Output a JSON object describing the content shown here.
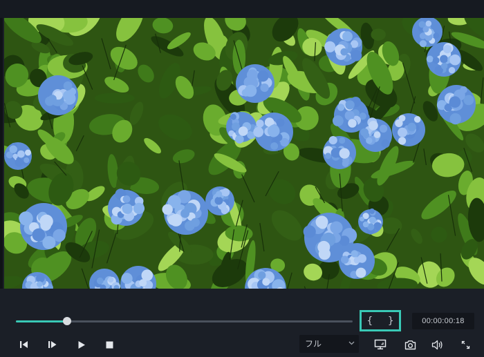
{
  "player": {
    "timecode": "00:00:00:18",
    "progress_fraction": 0.152,
    "mark_in_glyph": "{",
    "mark_out_glyph": "}",
    "quality_label": "フル"
  },
  "colors": {
    "accent": "#39c9b6",
    "background": "#1b1f27",
    "field_background": "#13161c"
  },
  "icons": {
    "prev_frame": "step-backward-icon",
    "next_frame": "step-forward-icon",
    "play": "play-icon",
    "stop": "stop-icon",
    "display": "monitor-icon",
    "snapshot": "camera-icon",
    "volume": "volume-icon",
    "fullscreen": "fullscreen-icon"
  }
}
